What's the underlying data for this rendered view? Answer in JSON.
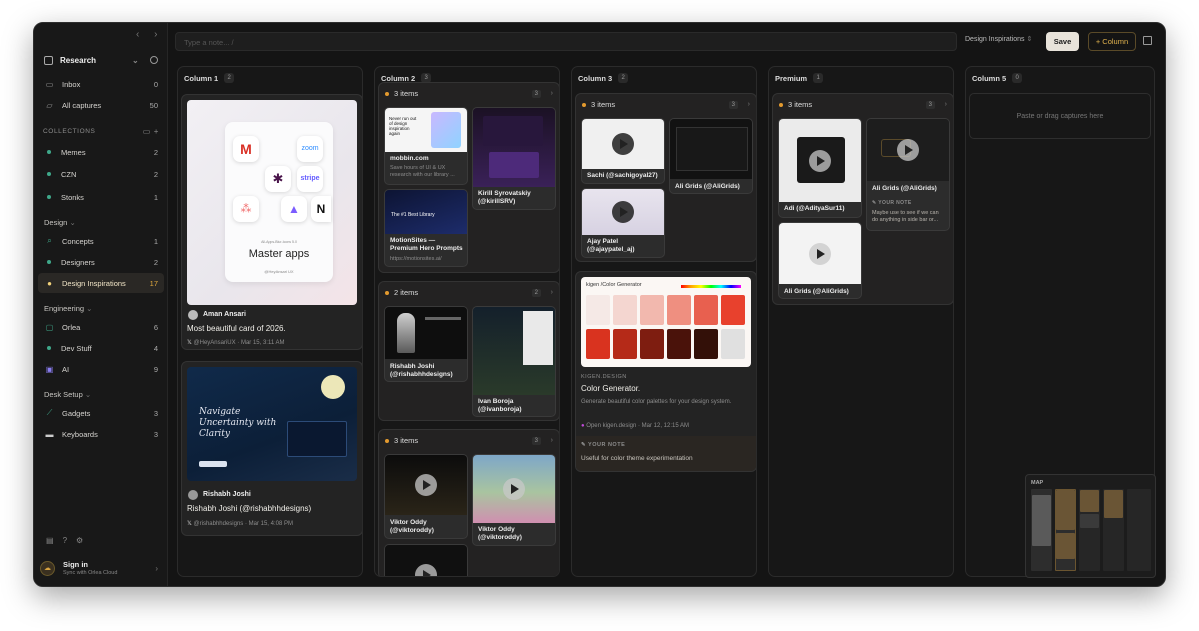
{
  "sidebar": {
    "workspace": "Research",
    "nav": [
      {
        "label": "Inbox",
        "count": "0"
      },
      {
        "label": "All captures",
        "count": "50"
      }
    ],
    "collections_header": "COLLECTIONS",
    "collections": [
      {
        "label": "Memes",
        "count": "2",
        "color": "#3fa88a"
      },
      {
        "label": "CZN",
        "count": "2",
        "color": "#3fa88a"
      },
      {
        "label": "Stonks",
        "count": "1",
        "color": "#3fa88a"
      }
    ],
    "groups": [
      {
        "header": "Design",
        "items": [
          {
            "label": "Concepts",
            "count": "1"
          },
          {
            "label": "Designers",
            "count": "2"
          },
          {
            "label": "Design Inspirations",
            "count": "17"
          }
        ]
      },
      {
        "header": "Engineering",
        "items": [
          {
            "label": "Orlea",
            "count": "6"
          },
          {
            "label": "Dev Stuff",
            "count": "4"
          },
          {
            "label": "AI",
            "count": "9"
          }
        ]
      },
      {
        "header": "Desk Setup",
        "items": [
          {
            "label": "Gadgets",
            "count": "3"
          },
          {
            "label": "Keyboards",
            "count": "3"
          }
        ]
      }
    ],
    "signin_title": "Sign in",
    "signin_sub": "Sync with Orlea Cloud"
  },
  "topbar": {
    "note_placeholder": "Type a note... /",
    "board_select": "Design Inspirations",
    "save_label": "Save",
    "column_label": "+ Column"
  },
  "columns": [
    {
      "title": "Column 1",
      "count": "2"
    },
    {
      "title": "Column 2",
      "count": "3"
    },
    {
      "title": "Column 3",
      "count": "2"
    },
    {
      "title": "Premium",
      "count": "1"
    },
    {
      "title": "Column 5",
      "count": "0"
    }
  ],
  "col1": {
    "card1": {
      "thumb_small": "All-Apps-Blur-Icons 5.0",
      "thumb_title": "Master apps",
      "thumb_sub": "@HeyAnsari UX",
      "icons": [
        "zoom",
        "stripe"
      ],
      "author": "Aman Ansari",
      "title": "Most beautiful card of 2026.",
      "meta": "@HeyAnsariUX · Mar 15, 3:11 AM"
    },
    "card2": {
      "thumb_title": "Navigate Uncertainty with Clarity",
      "author": "Rishabh Joshi",
      "title": "Rishabh Joshi (@rishabhhdesigns)",
      "meta": "@rishabhhdesigns · Mar 15, 4:08 PM"
    }
  },
  "col2": {
    "g1": {
      "label": "3 items",
      "count": "3",
      "a_title": "mobbin.com",
      "a_sub": "Save hours of UI & UX research with our library ...",
      "a_thumb": "Never run out of design inspiration again",
      "b_title": "Kirill Syrovatskiy (@kirillSRV)",
      "c_title": "MotionSites — Premium Hero Prompts",
      "c_sub": "https://motionsites.ai/",
      "c_thumb": "The #1 Best Library"
    },
    "g2": {
      "label": "2 items",
      "count": "2",
      "a_title": "Rishabh Joshi (@rishabhhdesigns)",
      "b_title": "Ivan Boroja (@ivanboroja)"
    },
    "g3": {
      "label": "3 items",
      "count": "3",
      "a_title": "Viktor Oddy (@viktoroddy)",
      "b_title": "Viktor Oddy (@viktoroddy)"
    }
  },
  "col3": {
    "g1": {
      "label": "3 items",
      "count": "3",
      "a_title": "Sachi (@sachigoyal27)",
      "b_title": "Ali Grids (@AliGrids)",
      "c_title": "Ajay Patel (@ajaypatel_aj)"
    },
    "card": {
      "thumb_title": "kigen /Color Generator",
      "source": "KIGEN.DESIGN",
      "title": "Color Generator.",
      "desc": "Generate beautiful color palettes for your design system.",
      "meta": "Open kigen.design · Mar 12, 12:15 AM",
      "note_label": "YOUR NOTE",
      "note": "Useful for color theme experimentation",
      "swatches": [
        "#f5e9e6",
        "#f4d6d0",
        "#f2b8ae",
        "#ef8f80",
        "#e8604f",
        "#e8412d",
        "#d9331f",
        "#b52a18",
        "#7e1d10",
        "#4a120a",
        "#331008",
        "#e0e0e0"
      ]
    }
  },
  "col4": {
    "g1": {
      "label": "3 items",
      "count": "3",
      "a_title": "Adi (@AdityaSur11)",
      "b_title": "Ali Grids (@AliGrids)",
      "b_note_label": "YOUR NOTE",
      "b_note": "Maybe use to see if we can do anything in side bar or...",
      "c_title": "Ali Grids (@AliGrids)"
    }
  },
  "col5": {
    "empty": "Paste or drag captures here"
  },
  "map": {
    "label": "MAP"
  },
  "colors": {
    "accent": "#e0a93e",
    "bg": "#141414",
    "save_bg": "#e8e3da"
  }
}
